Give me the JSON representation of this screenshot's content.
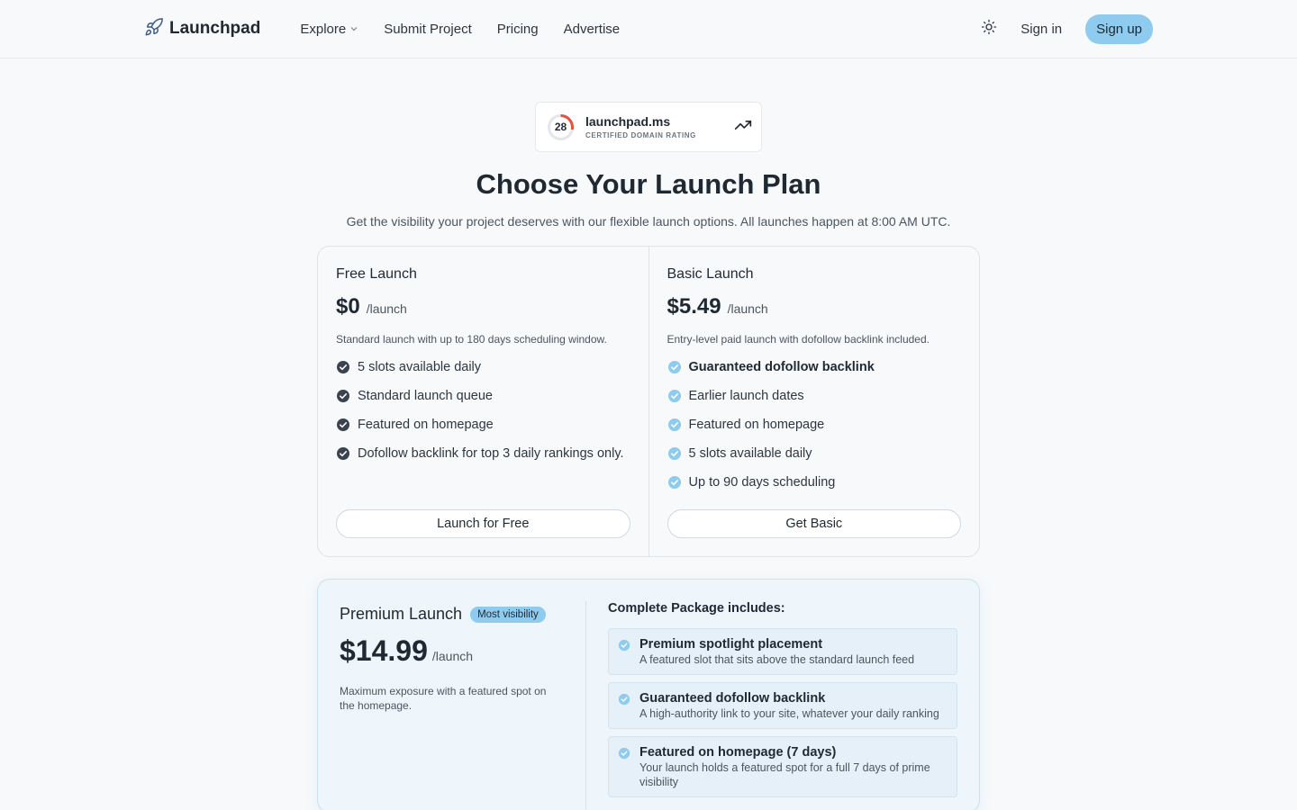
{
  "header": {
    "brand": "Launchpad",
    "nav": [
      {
        "label": "Explore",
        "dropdown": true
      },
      {
        "label": "Submit Project"
      },
      {
        "label": "Pricing"
      },
      {
        "label": "Advertise"
      }
    ],
    "theme_toggle_icon": "sun-icon",
    "sign_in": "Sign in",
    "sign_up": "Sign up"
  },
  "domain_badge": {
    "rating": "28",
    "domain": "launchpad.ms",
    "caption": "CERTIFIED DOMAIN RATING",
    "rating_fraction": 0.28,
    "ring_color": "#e8503a"
  },
  "hero": {
    "title": "Choose Your Launch Plan",
    "subtitle": "Get the visibility your project deserves with our flexible launch options. All launches happen at 8:00 AM UTC."
  },
  "plans": [
    {
      "name": "Free Launch",
      "price": "$0",
      "per": "/launch",
      "description": "Standard launch with up to 180 days scheduling window.",
      "check_color": "#3a4450",
      "features": [
        {
          "text": "5 slots available daily",
          "bold": false
        },
        {
          "text": "Standard launch queue",
          "bold": false
        },
        {
          "text": "Featured on homepage",
          "bold": false
        },
        {
          "text": "Dofollow backlink for top 3 daily rankings only.",
          "bold": false
        }
      ],
      "button": "Launch for Free"
    },
    {
      "name": "Basic Launch",
      "price": "$5.49",
      "per": "/launch",
      "description": "Entry-level paid launch with dofollow backlink included.",
      "check_color": "#8fcbee",
      "features": [
        {
          "text": "Guaranteed dofollow backlink",
          "bold": true
        },
        {
          "text": "Earlier launch dates",
          "bold": false
        },
        {
          "text": "Featured on homepage",
          "bold": false
        },
        {
          "text": "5 slots available daily",
          "bold": false
        },
        {
          "text": "Up to 90 days scheduling",
          "bold": false
        }
      ],
      "button": "Get Basic"
    }
  ],
  "premium": {
    "name": "Premium Launch",
    "tag": "Most visibility",
    "price": "$14.99",
    "per": "/launch",
    "description": "Maximum exposure with a featured spot on the homepage.",
    "package_title": "Complete Package includes:",
    "items": [
      {
        "title": "Premium spotlight placement",
        "desc": "A featured slot that sits above the standard launch feed"
      },
      {
        "title": "Guaranteed dofollow backlink",
        "desc": "A high-authority link to your site, whatever your daily ranking"
      },
      {
        "title": "Featured on homepage (7 days)",
        "desc": "Your launch holds a featured spot for a full 7 days of prime visibility"
      }
    ]
  },
  "colors": {
    "accent": "#8fcbee",
    "text": "#1f2933",
    "background": "#f7f9fb"
  }
}
